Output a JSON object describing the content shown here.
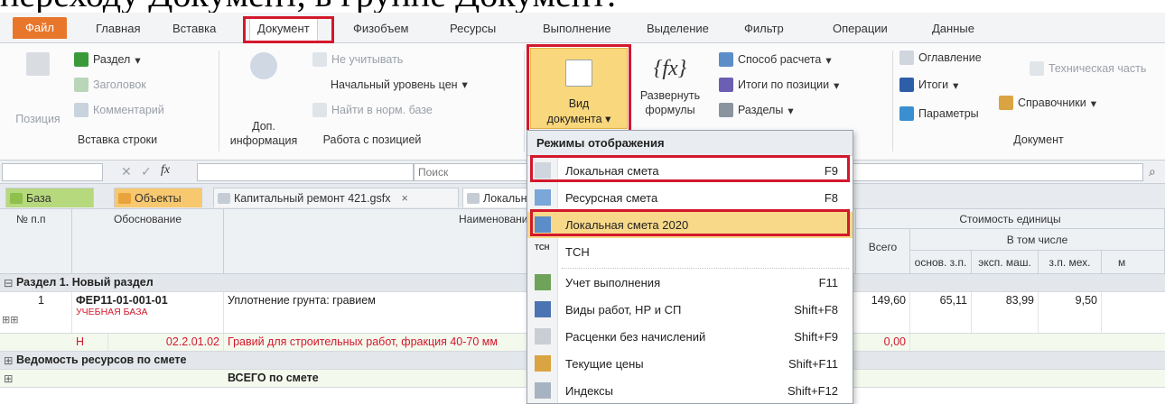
{
  "caption_fragment": "переходу Документ, в группе Документ:",
  "tabs": [
    {
      "label": "Файл"
    },
    {
      "label": "Главная"
    },
    {
      "label": "Вставка"
    },
    {
      "label": "Документ"
    },
    {
      "label": "Физобъем"
    },
    {
      "label": "Ресурсы"
    },
    {
      "label": "Выполнение"
    },
    {
      "label": "Выделение"
    },
    {
      "label": "Фильтр"
    },
    {
      "label": "Операции"
    },
    {
      "label": "Данные"
    }
  ],
  "ribbon": {
    "insert_rows": {
      "position": "Позиция",
      "section": "Раздел",
      "heading": "Заголовок",
      "comment": "Комментарий",
      "group": "Вставка строки"
    },
    "position_work": {
      "extra_info_1": "Доп.",
      "extra_info_2": "информация",
      "ignore": "Не учитывать",
      "price_level": "Начальный уровень цен",
      "find_in_base": "Найти в норм. базе",
      "group": "Работа с позицией"
    },
    "vid_1": "Вид",
    "vid_2": "документа",
    "fx_label": "{fx}",
    "expand_1": "Развернуть",
    "expand_2": "формулы",
    "calc_method": "Способ расчета",
    "pos_totals": "Итоги по позиции",
    "sections": "Разделы",
    "document": {
      "toc": "Оглавление",
      "tech_part": "Техническая часть",
      "totals": "Итоги",
      "params": "Параметры",
      "references": "Справочники",
      "group": "Документ"
    }
  },
  "formula_bar": {
    "search_placeholder": "Поиск",
    "fx": "fx"
  },
  "doc_tabs": [
    {
      "label": "База"
    },
    {
      "label": "Объекты"
    },
    {
      "label": "Капитальный ремонт 421.gsfx",
      "close": "×"
    },
    {
      "label": "Локальн"
    }
  ],
  "grid": {
    "headers": {
      "num": "№ п.п",
      "basis": "Обоснование",
      "name": "Наименование",
      "unit_cost": "Стоимость единицы",
      "total": "Всего",
      "incl": "В том числе",
      "osn_zp": "основ. з.п.",
      "eksp_mash": "эксп. маш.",
      "zp_meh": "з.п. мех.",
      "m": "м"
    },
    "section_title": "Раздел 1. Новый раздел",
    "row1": {
      "num": "1",
      "code": "ФЕР11-01-001-01",
      "base": "УЧЕБНАЯ БАЗА",
      "name": "Уплотнение грунта: гравием",
      "total": "149,60",
      "osn": "65,11",
      "eksp": "83,99",
      "meh": "9,50"
    },
    "row2": {
      "flag": "Н",
      "code": "02.2.01.02",
      "name": "Гравий для строительных работ, фракция 40-70 мм",
      "total": "0,00"
    },
    "resources": "Ведомость ресурсов по смете",
    "total_row": "ВСЕГО по смете"
  },
  "menu": {
    "title": "Режимы отображения",
    "items": [
      {
        "label": "Локальная смета",
        "shortcut": "F9"
      },
      {
        "label": "Ресурсная смета",
        "shortcut": "F8"
      },
      {
        "label": "Локальная смета 2020",
        "shortcut": ""
      },
      {
        "label": "ТСН",
        "shortcut": ""
      },
      {
        "label": "Учет выполнения",
        "shortcut": "F11"
      },
      {
        "label": "Виды работ, НР и СП",
        "shortcut": "Shift+F8"
      },
      {
        "label": "Расценки без начислений",
        "shortcut": "Shift+F9"
      },
      {
        "label": "Текущие цены",
        "shortcut": "Shift+F11"
      },
      {
        "label": "Индексы",
        "shortcut": "Shift+F12"
      }
    ]
  },
  "colors": {
    "accent_red": "#d3182c",
    "file_tab": "#e8762b",
    "highlight_yellow": "#f8d98a",
    "link_red": "#d3182c",
    "section_bg": "#e3e6ea"
  }
}
